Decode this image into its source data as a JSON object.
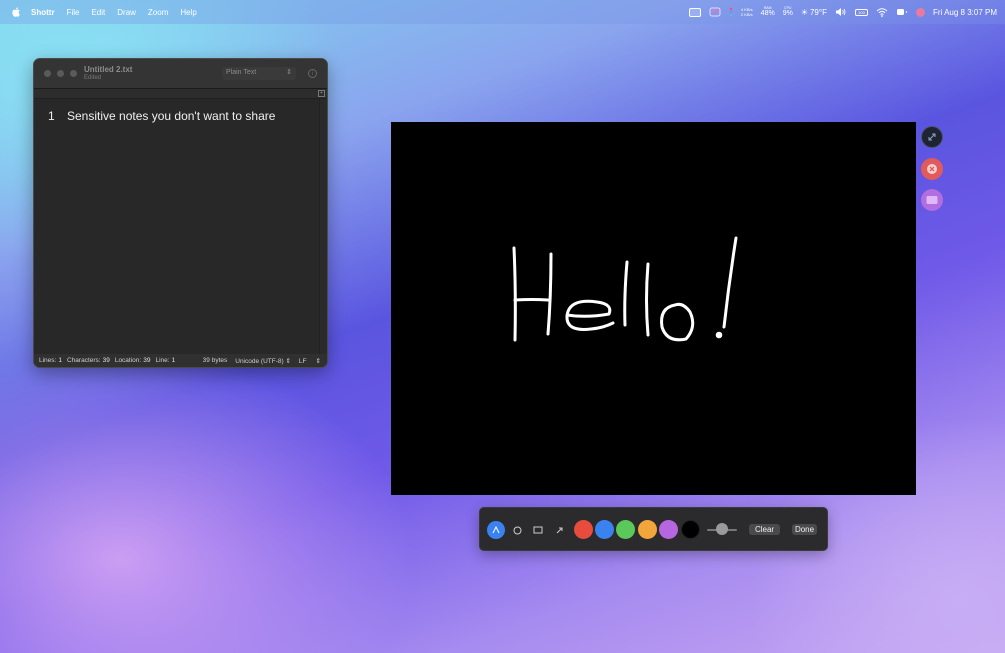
{
  "menubar": {
    "app_name": "Shottr",
    "items": [
      "File",
      "Edit",
      "Draw",
      "Zoom",
      "Help"
    ],
    "net_up": "4 KB/s",
    "net_down": "2 KB/s",
    "ram_label": "RAM",
    "ram_value": "48%",
    "cpu_label": "CPU",
    "cpu_value": "9%",
    "weather": "79°F",
    "battery_label": "100",
    "datetime": "Fri Aug 8  3:07 PM"
  },
  "editor": {
    "title": "Untitled 2.txt",
    "subtitle": "Edited",
    "format": "Plain Text",
    "line_number": "1",
    "content": "Sensitive notes you don't want to share",
    "status": {
      "lines_label": "Lines:",
      "lines": "1",
      "chars_label": "Characters:",
      "chars": "39",
      "location_label": "Location:",
      "location": "39",
      "line_label": "Line:",
      "line": "1",
      "bytes": "39 bytes",
      "encoding": "Unicode (UTF-8)",
      "line_ending": "LF"
    }
  },
  "canvas": {
    "drawing_text": "Hello!"
  },
  "toolbar": {
    "colors": [
      "#e84c3d",
      "#3a82f0",
      "#5ac85a",
      "#f2a53a",
      "#b566e0",
      "#000000"
    ],
    "clear_label": "Clear",
    "done_label": "Done",
    "stroke_width_fraction": 0.5
  }
}
